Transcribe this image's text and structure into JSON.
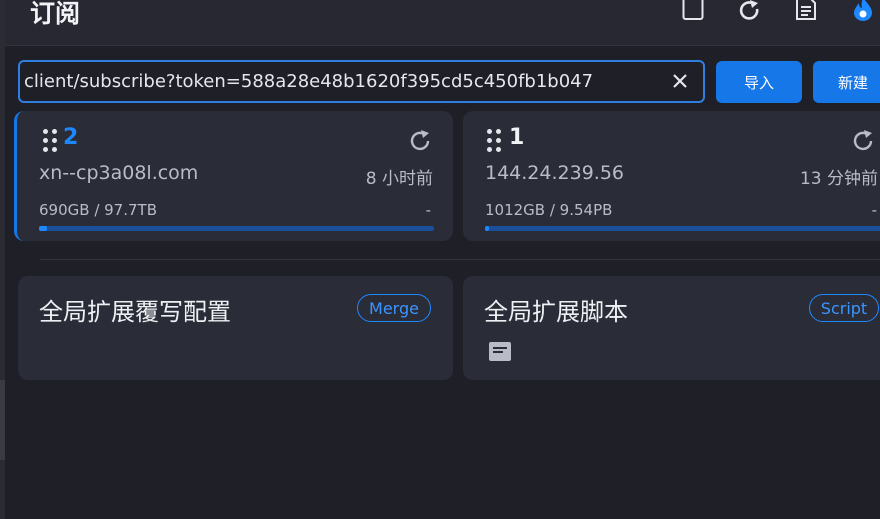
{
  "header": {
    "title": "订阅"
  },
  "subscribe_input": {
    "value": "client/subscribe?token=588a28e48b1620f395cd5c450fb1b047"
  },
  "actions": {
    "import_label": "导入",
    "new_label": "新建"
  },
  "profiles": [
    {
      "name": "2",
      "host": "xn--cp3a08l.com",
      "updated": "8 小时前",
      "usage": "690GB / 97.7TB",
      "expire": "-",
      "usage_fraction": 0.007,
      "selected": true
    },
    {
      "name": "1",
      "host": "144.24.239.56",
      "updated": "13 分钟前",
      "usage": "1012GB / 9.54PB",
      "expire": "-",
      "usage_fraction": 0.001,
      "selected": false
    }
  ],
  "extensions": [
    {
      "title": "全局扩展覆写配置",
      "tag": "Merge"
    },
    {
      "title": "全局扩展脚本",
      "tag": "Script"
    }
  ],
  "colors": {
    "accent": "#1677e8",
    "background": "#1e1f27",
    "card": "#2a2c37"
  }
}
